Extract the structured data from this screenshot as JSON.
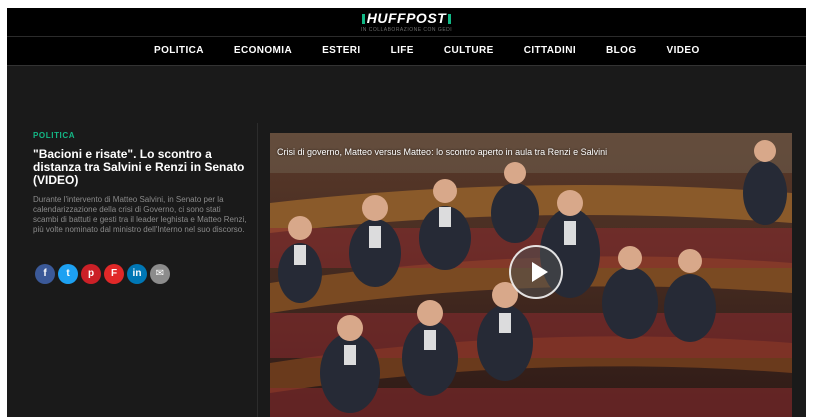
{
  "header": {
    "logo": "HUFFPOST",
    "tagline": "IN COLLABORAZIONE CON GEDI"
  },
  "nav": {
    "items": [
      "POLITICA",
      "ECONOMIA",
      "ESTERI",
      "LIFE",
      "CULTURE",
      "CITTADINI",
      "BLOG",
      "VIDEO"
    ]
  },
  "article": {
    "category": "POLITICA",
    "headline": "\"Bacioni e risate\". Lo scontro a distanza tra Salvini e Renzi in Senato (VIDEO)",
    "summary": "Durante l'intervento di Matteo Salvini, in Senato per la calendarizzazione della crisi di Governo, ci sono stati scambi di battuti e gesti tra il leader leghista e Matteo Renzi, più volte nominato dal ministro dell'Interno nel suo discorso."
  },
  "share": {
    "buttons": [
      {
        "label": "f",
        "icon": "facebook-icon",
        "color": "#3b5998"
      },
      {
        "label": "t",
        "icon": "twitter-icon",
        "color": "#1da1f2"
      },
      {
        "label": "p",
        "icon": "pinterest-icon",
        "color": "#cb2027"
      },
      {
        "label": "F",
        "icon": "flipboard-icon",
        "color": "#e12828"
      },
      {
        "label": "in",
        "icon": "linkedin-icon",
        "color": "#0077b5"
      },
      {
        "label": "✉",
        "icon": "email-icon",
        "color": "#8c8c8c"
      }
    ]
  },
  "video": {
    "caption": "Crisi di governo, Matteo versus Matteo: lo scontro aperto in aula tra Renzi e Salvini"
  },
  "colors": {
    "accent": "#14b886",
    "background": "#1a1a1a",
    "header": "#000000"
  }
}
